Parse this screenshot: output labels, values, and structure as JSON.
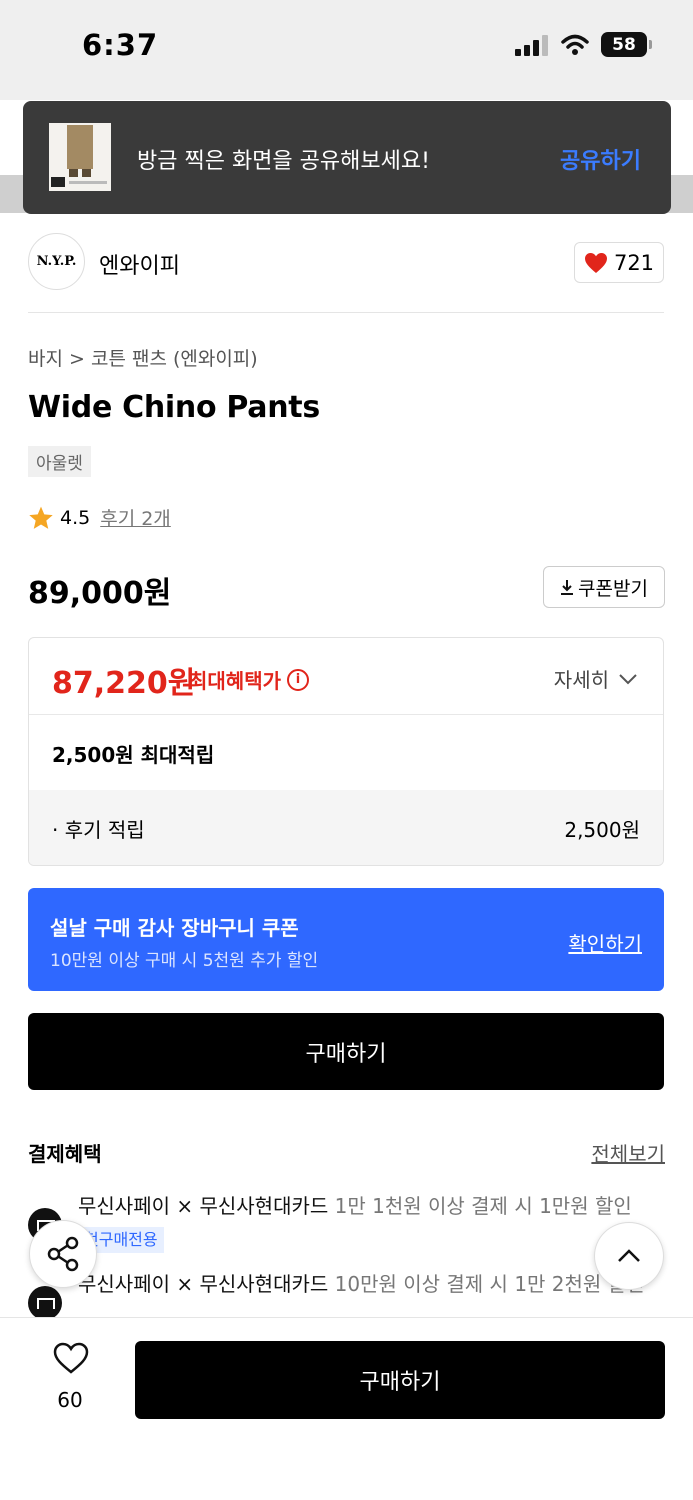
{
  "status": {
    "time": "6:37",
    "battery": "58"
  },
  "toast": {
    "message": "방금 찍은 화면을 공유해보세요!",
    "action": "공유하기"
  },
  "brand": {
    "logo": "N.Y.P.",
    "name": "엔와이피",
    "likes": "721"
  },
  "product": {
    "breadcrumb": "바지 > 코튼 팬츠 (엔와이피)",
    "title": "Wide Chino Pants",
    "tag": "아울렛",
    "rating": "4.5",
    "reviews": "후기 2개",
    "price": "89,000원",
    "coupon_button": "쿠폰받기"
  },
  "benefit": {
    "max_price": "87,220원",
    "max_label": "최대혜택가",
    "detail": "자세히",
    "points": "2,500원 최대적립",
    "review_points_label": "· 후기 적립",
    "review_points_value": "2,500원"
  },
  "banner": {
    "title": "설날 구매 감사 장바구니 쿠폰",
    "subtitle": "10만원 이상 구매 시 5천원 추가 할인",
    "cta": "확인하기"
  },
  "buy_label": "구매하기",
  "payment": {
    "title": "결제혜택",
    "view_all": "전체보기",
    "items": [
      {
        "bold": "무신사페이 × 무신사현대카드",
        "desc": "1만 1천원 이상 결제 시 1만원 할인",
        "badge": "첫구매전용"
      },
      {
        "bold": "무신사페이 × 무신사현대카드",
        "desc": "10만원 이상 결제 시 1만 2천원 할인"
      }
    ]
  },
  "bottom": {
    "wish_count": "60",
    "buy_label": "구매하기"
  },
  "colors": {
    "accent_red": "#e1251b",
    "accent_blue": "#2f68ff",
    "toast_link": "#3b7cff"
  }
}
